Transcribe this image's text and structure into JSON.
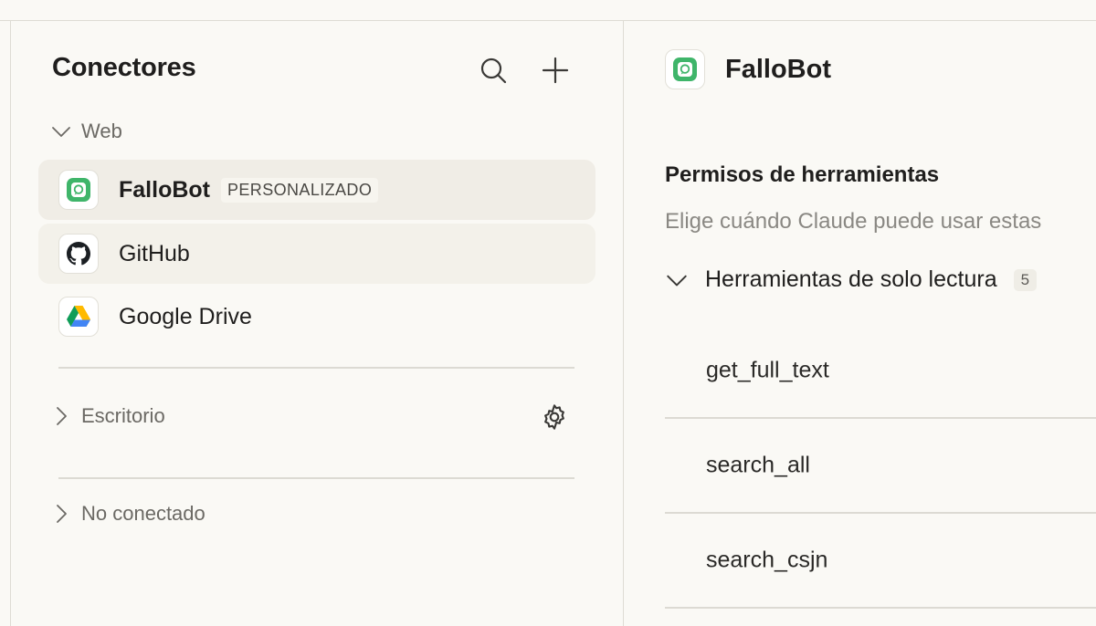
{
  "sidebar": {
    "title": "Conectores",
    "sections": {
      "web": {
        "label": "Web"
      },
      "desktop": {
        "label": "Escritorio"
      },
      "not_connected": {
        "label": "No conectado"
      }
    },
    "connectors": [
      {
        "name": "FalloBot",
        "badge": "PERSONALIZADO"
      },
      {
        "name": "GitHub"
      },
      {
        "name": "Google Drive"
      }
    ]
  },
  "detail": {
    "title": "FalloBot",
    "permissions_title": "Permisos de herramientas",
    "permissions_desc": "Elige cuándo Claude puede usar estas",
    "group": {
      "label": "Herramientas de solo lectura",
      "count": "5"
    },
    "tools": [
      "get_full_text",
      "search_all",
      "search_csjn"
    ]
  },
  "colors": {
    "background": "#faf9f5",
    "selected_row": "#f0ede6",
    "fallobot_green": "#3fb56a",
    "muted_text": "#8a8883"
  },
  "icons": {
    "search": "search-icon",
    "add": "plus-icon",
    "chevron_down": "chevron-down-icon",
    "chevron_right": "chevron-right-icon",
    "settings": "gear-icon",
    "fallobot": "fallobot-logo-icon",
    "github": "github-logo-icon",
    "gdrive": "google-drive-logo-icon"
  }
}
